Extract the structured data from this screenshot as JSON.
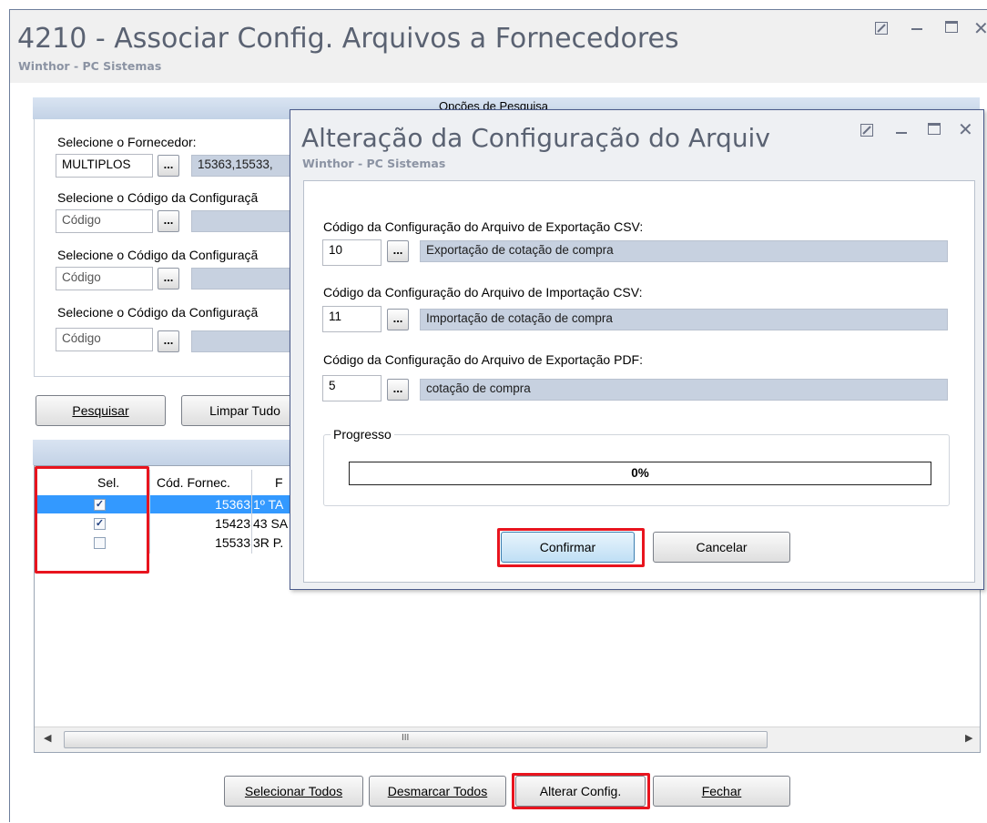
{
  "main": {
    "title": "4210 - Associar Config. Arquivos a Fornecedores",
    "subtitle": "Winthor - PC Sistemas",
    "section_search": "Opções de Pesquisa",
    "supplier_label": "Selecione o Fornecedor:",
    "supplier_value": "MULTIPLOS",
    "supplier_list": "15363,15533,",
    "config_label": "Selecione o Código da Configuraçã",
    "code_placeholder": "Código",
    "btn_search": "Pesquisar",
    "btn_clear": "Limpar Tudo",
    "grid_headers": [
      "Sel.",
      "Cód. Fornec.",
      "F"
    ],
    "rows": [
      {
        "code": "15363",
        "name": "1º TA",
        "checked": true,
        "selected": true
      },
      {
        "code": "15423",
        "name": "43 SA",
        "checked": true,
        "selected": false
      },
      {
        "code": "15533",
        "name": "3R P.",
        "checked": false,
        "selected": false
      }
    ],
    "scroll_glyph": "III",
    "btn_select_all": "Selecionar Todos",
    "btn_unselect_all": "Desmarcar Todos",
    "btn_change": "Alterar Config.",
    "btn_close": "Fechar"
  },
  "dialog": {
    "title": "Alteração da Configuração do Arquiv",
    "subtitle": "Winthor - PC Sistemas",
    "csv_export_label": "Código da Configuração do Arquivo de Exportação CSV:",
    "csv_export_code": "10",
    "csv_export_desc": "Exportação de cotação de compra",
    "csv_import_label": "Código da Configuração do Arquivo de Importação CSV:",
    "csv_import_code": "11",
    "csv_import_desc": "Importação de cotação de compra",
    "pdf_export_label": "Código da Configuração do Arquivo de Exportação PDF:",
    "pdf_export_code": "5",
    "pdf_export_desc": "cotação de compra",
    "progress_label": "Progresso",
    "progress_text": "0%",
    "btn_confirm": "Confirmar",
    "btn_cancel": "Cancelar"
  },
  "colors": {
    "highlight": "#e8141e",
    "row_selected": "#3399ff"
  },
  "icons": {
    "minimize": "minimize-icon",
    "maximize": "maximize-icon",
    "close": "close-icon",
    "ellipsis": "..."
  }
}
